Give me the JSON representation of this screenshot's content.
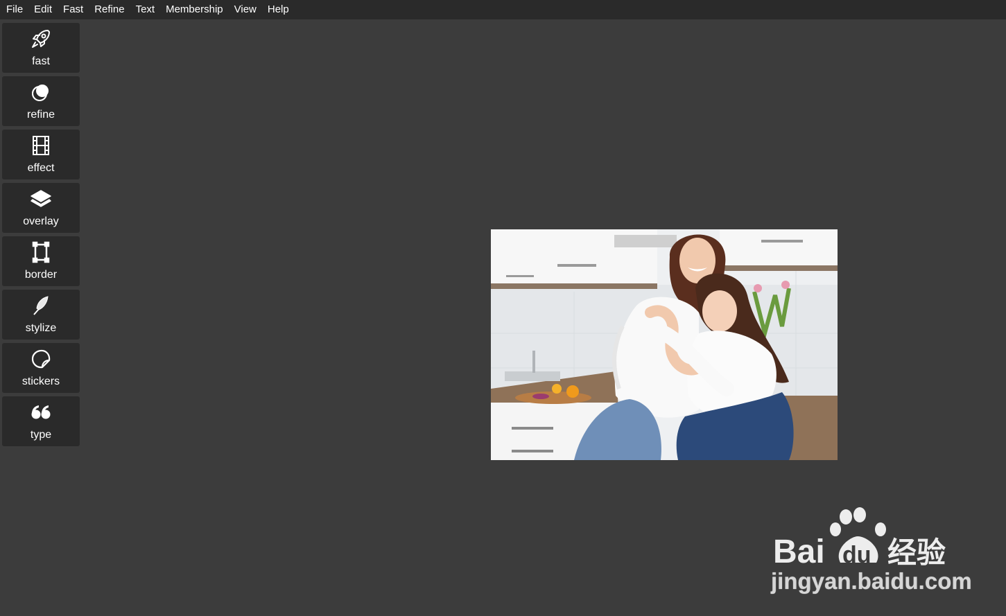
{
  "menubar": {
    "items": [
      "File",
      "Edit",
      "Fast",
      "Refine",
      "Text",
      "Membership",
      "View",
      "Help"
    ]
  },
  "sidebar": {
    "tools": [
      {
        "label": "fast",
        "icon": "rocket-icon"
      },
      {
        "label": "refine",
        "icon": "circles-icon"
      },
      {
        "label": "effect",
        "icon": "film-icon"
      },
      {
        "label": "overlay",
        "icon": "layers-icon"
      },
      {
        "label": "border",
        "icon": "frame-icon"
      },
      {
        "label": "stylize",
        "icon": "feather-icon"
      },
      {
        "label": "stickers",
        "icon": "sticker-icon"
      },
      {
        "label": "type",
        "icon": "quote-icon"
      }
    ]
  },
  "canvas": {
    "image": "photo-mother-daughter-hugging-kitchen"
  },
  "watermark": {
    "logo": "Bai du 经验",
    "url": "jingyan.baidu.com"
  },
  "colors": {
    "background": "#3c3c3c",
    "panel": "#2a2a2a",
    "text": "#ffffff"
  }
}
